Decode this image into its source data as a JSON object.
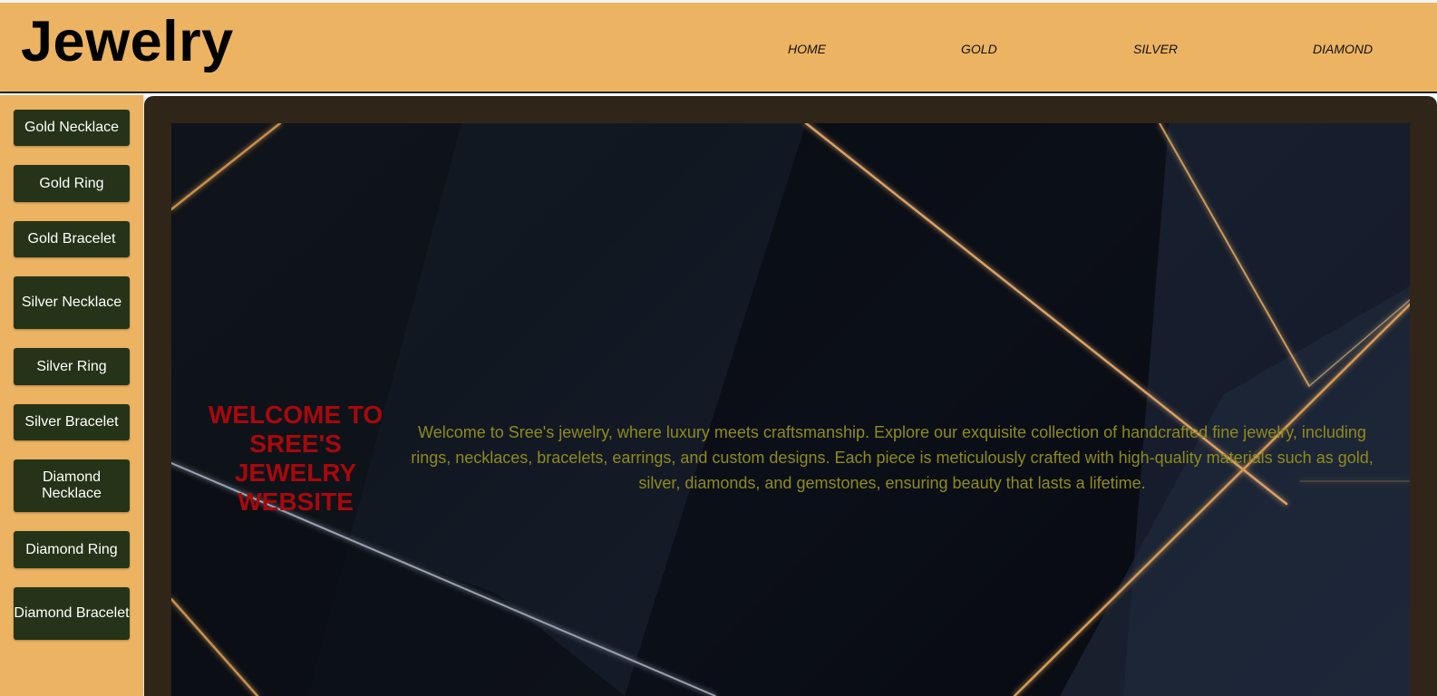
{
  "header": {
    "logo": "Jewelry",
    "nav": [
      "HOME",
      "GOLD",
      "SILVER",
      "DIAMOND"
    ]
  },
  "sidebar": {
    "items": [
      "Gold Necklace",
      "Gold Ring",
      "Gold Bracelet",
      "Silver Necklace",
      "Silver Ring",
      "Silver Bracelet",
      "Diamond Necklace",
      "Diamond Ring",
      "Diamond Bracelet"
    ]
  },
  "hero": {
    "welcome": "WELCOME TO SREE'S JEWELRY WEBSITE",
    "intro": "Welcome to Sree's jewelry, where luxury meets craftsmanship. Explore our exquisite collection of handcrafted fine jewelry, including rings, necklaces, bracelets, earrings, and custom designs. Each piece is meticulously crafted with high-quality materials such as gold, silver, diamonds, and gemstones, ensuring beauty that lasts a lifetime."
  },
  "colors": {
    "header_bg": "#ecb362",
    "button_bg": "#253418",
    "frame_bg": "#2f2518",
    "welcome_text": "#a8080c",
    "intro_text": "#8f8b1c"
  }
}
